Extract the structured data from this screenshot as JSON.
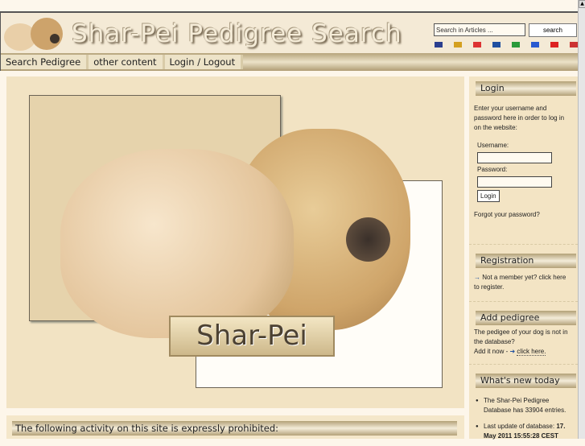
{
  "header": {
    "title": "Shar-Pei Pedigree Search",
    "search_placeholder": "Search in Articles ...",
    "search_button": "search",
    "flags": [
      {
        "name": "uk",
        "color": "#2b3f8f"
      },
      {
        "name": "de",
        "color": "#d4a020"
      },
      {
        "name": "es",
        "color": "#d33"
      },
      {
        "name": "cz",
        "color": "#1f4fa0"
      },
      {
        "name": "it",
        "color": "#2a9a3a"
      },
      {
        "name": "fr",
        "color": "#2a5ad0"
      },
      {
        "name": "pl",
        "color": "#d22"
      },
      {
        "name": "hu",
        "color": "#c33"
      }
    ]
  },
  "nav": [
    "Search Pedigree",
    "other content",
    "Login / Logout"
  ],
  "hero": {
    "plaque": "Shar-Pei"
  },
  "notice": "The following activity on this site is expressly prohibited:",
  "sidebar": {
    "login": {
      "title": "Login",
      "intro": "Enter your username and password here in order to log in on the website:",
      "username_label": "Username:",
      "password_label": "Password:",
      "button": "Login",
      "forgot": "Forgot your password?"
    },
    "registration": {
      "title": "Registration",
      "text": "Not a member yet? click here to register."
    },
    "add_pedigree": {
      "title": "Add pedigree",
      "text": "The pedigee of your dog is not in the database?",
      "add_prefix": "Add it now -",
      "link": "click here."
    },
    "whats_new": {
      "title": "What's new today",
      "items": [
        "The Shar-Pei Pedigree Database has 33904 entries."
      ],
      "update_label": "Last update of database:",
      "update_value": "17. May 2011 15:55:28 CEST"
    }
  }
}
